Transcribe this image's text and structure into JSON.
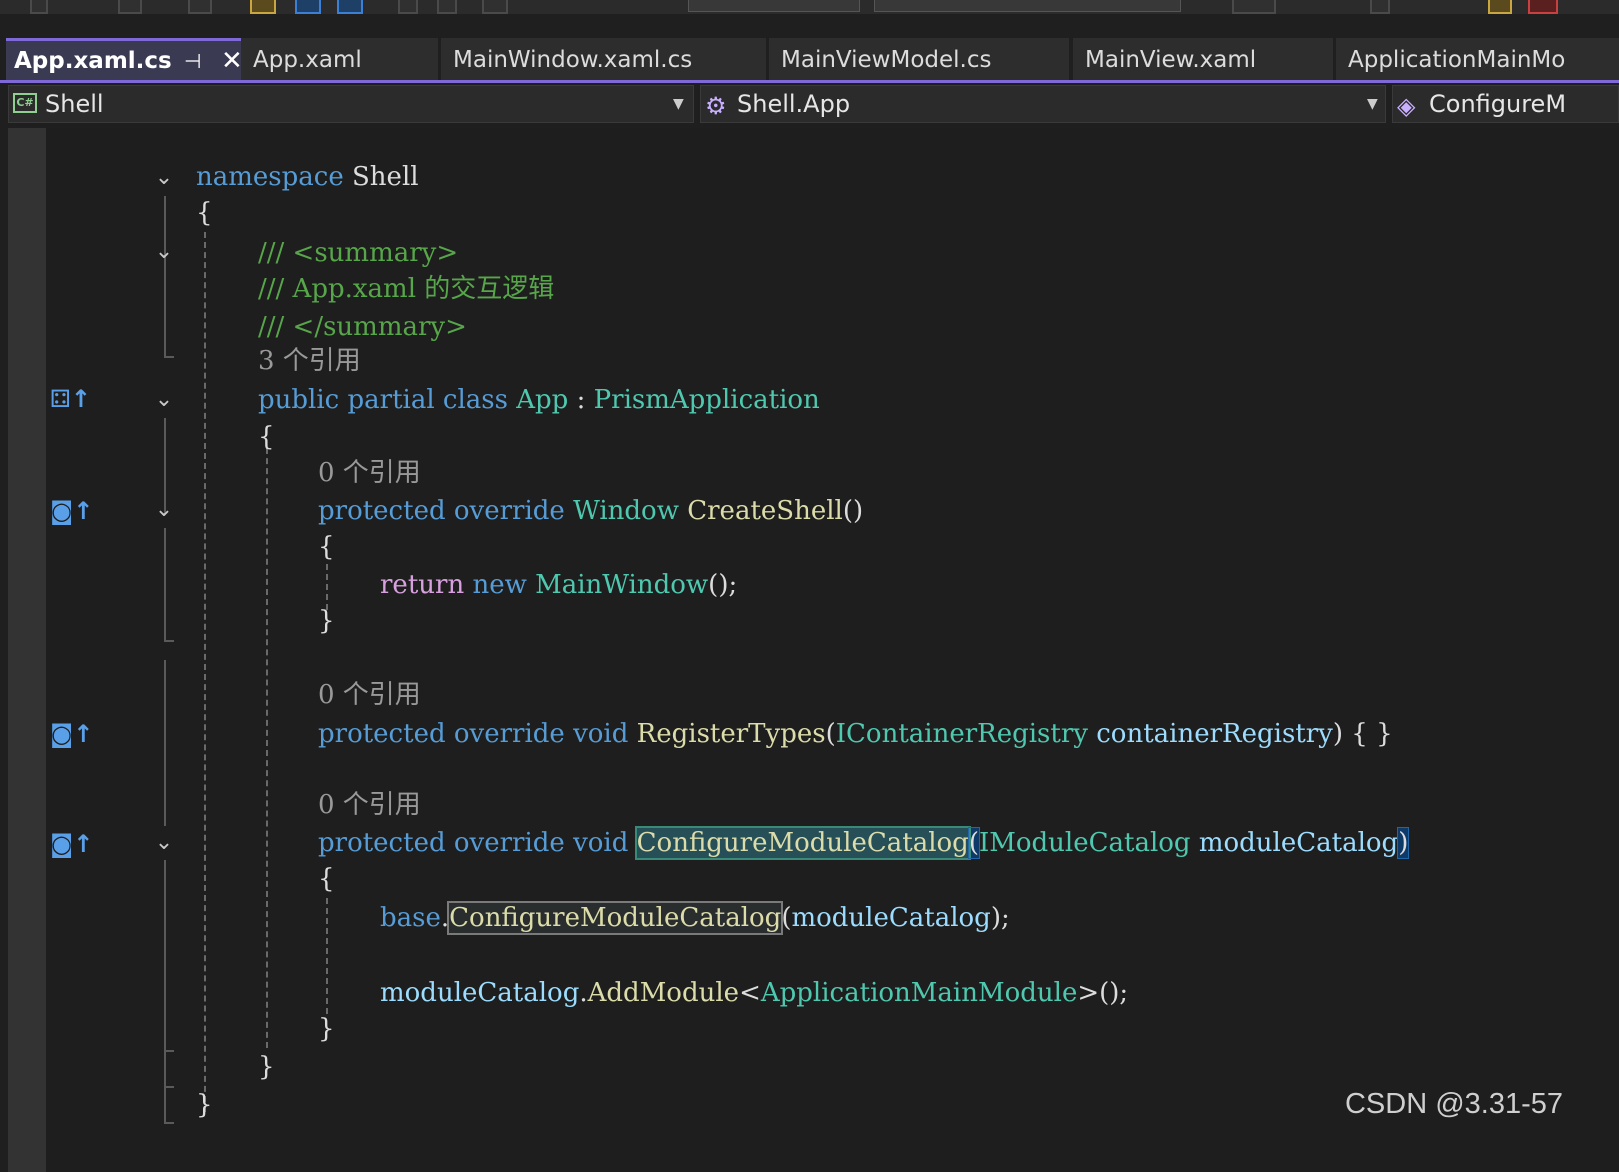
{
  "tabs": [
    {
      "label": "App.xaml.cs",
      "active": true
    },
    {
      "label": "App.xaml"
    },
    {
      "label": "MainWindow.xaml.cs"
    },
    {
      "label": "MainViewModel.cs"
    },
    {
      "label": "MainView.xaml"
    },
    {
      "label": "ApplicationMainMo"
    }
  ],
  "tab_pin_icon": "pin-icon",
  "tab_close_icon": "close-icon",
  "nav": {
    "project": "Shell",
    "type": "Shell.App",
    "member": "ConfigureM"
  },
  "code": {
    "ns_kw": "namespace",
    "ns_name": "Shell",
    "c1": "/// <summary>",
    "c2": "/// App.xaml 的交互逻辑",
    "c3": "/// </summary>",
    "refs3": "3 个引用",
    "refs0": "0 个引用",
    "public": "public",
    "partial": "partial",
    "class": "class",
    "app": "App",
    "colon": ":",
    "prism": "PrismApplication",
    "protected": "protected",
    "override": "override",
    "window": "Window",
    "createshell": "CreateShell",
    "parens": "()",
    "return": "return",
    "new": "new",
    "mainwindow": "MainWindow",
    "semi": "();",
    "void": "void",
    "registertypes": "RegisterTypes",
    "icr": "IContainerRegistry",
    "cr": "containerRegistry",
    "emptybody": "{ }",
    "cmc": "ConfigureModuleCatalog",
    "imc": "IModuleCatalog",
    "mc": "moduleCatalog",
    "base": "base",
    "addmodule": "AddModule",
    "amm": "ApplicationMainModule",
    "ob": "{",
    "cb": "}",
    "lp": "(",
    "rp": ")",
    "dot": ".",
    "lt": "<",
    "gt": ">",
    "call_end": ">();",
    "rp_semi": ");"
  },
  "watermark": "CSDN @3.31-57",
  "colors": {
    "keyword": "#569cd6",
    "type": "#4ec9b0",
    "method": "#dcdcaa",
    "param": "#9cdcfe",
    "comment": "#57a64a",
    "control": "#d8a0df",
    "accent": "#7f68d8"
  }
}
